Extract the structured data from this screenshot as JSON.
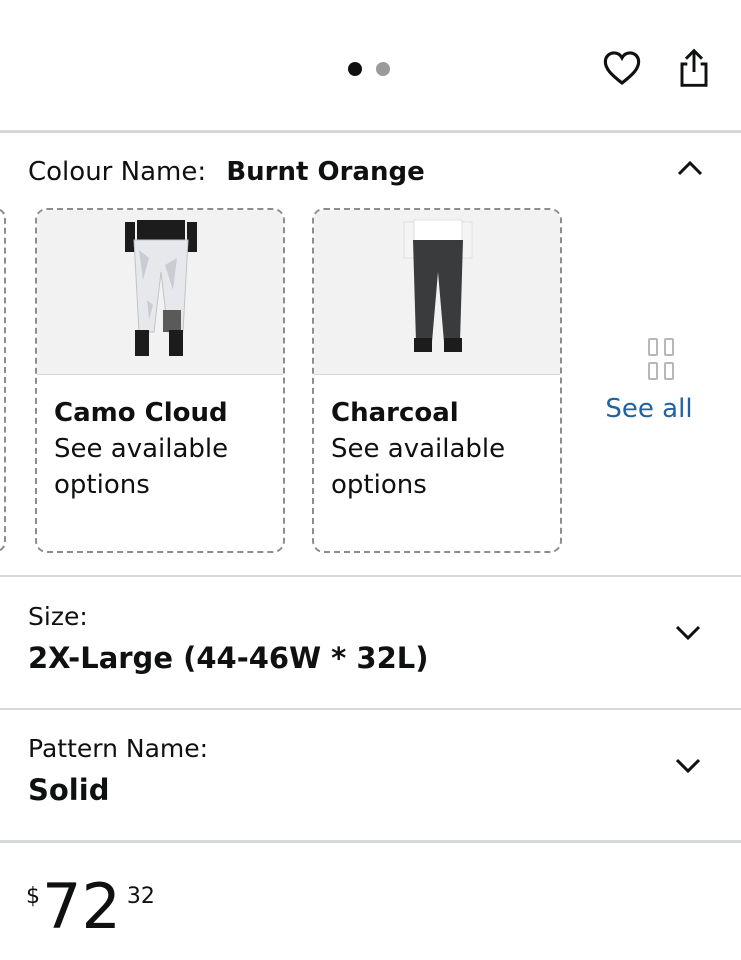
{
  "carousel": {
    "dots": [
      true,
      false
    ]
  },
  "header": {
    "heart_icon": "heart-icon",
    "share_icon": "share-icon"
  },
  "colour": {
    "label": "Colour Name:",
    "selected": "Burnt Orange",
    "options": [
      {
        "name": "Camo Cloud",
        "sub": "See available options"
      },
      {
        "name": "Charcoal",
        "sub": "See available options"
      }
    ],
    "see_all": "See all"
  },
  "size": {
    "label": "Size:",
    "value": "2X-Large (44-46W * 32L)"
  },
  "pattern": {
    "label": "Pattern Name:",
    "value": "Solid"
  },
  "price": {
    "currency": "$",
    "whole": "72",
    "fraction": "32"
  },
  "colors": {
    "link": "#2162a1",
    "text": "#0f1111",
    "divider": "#d5d9d9"
  }
}
